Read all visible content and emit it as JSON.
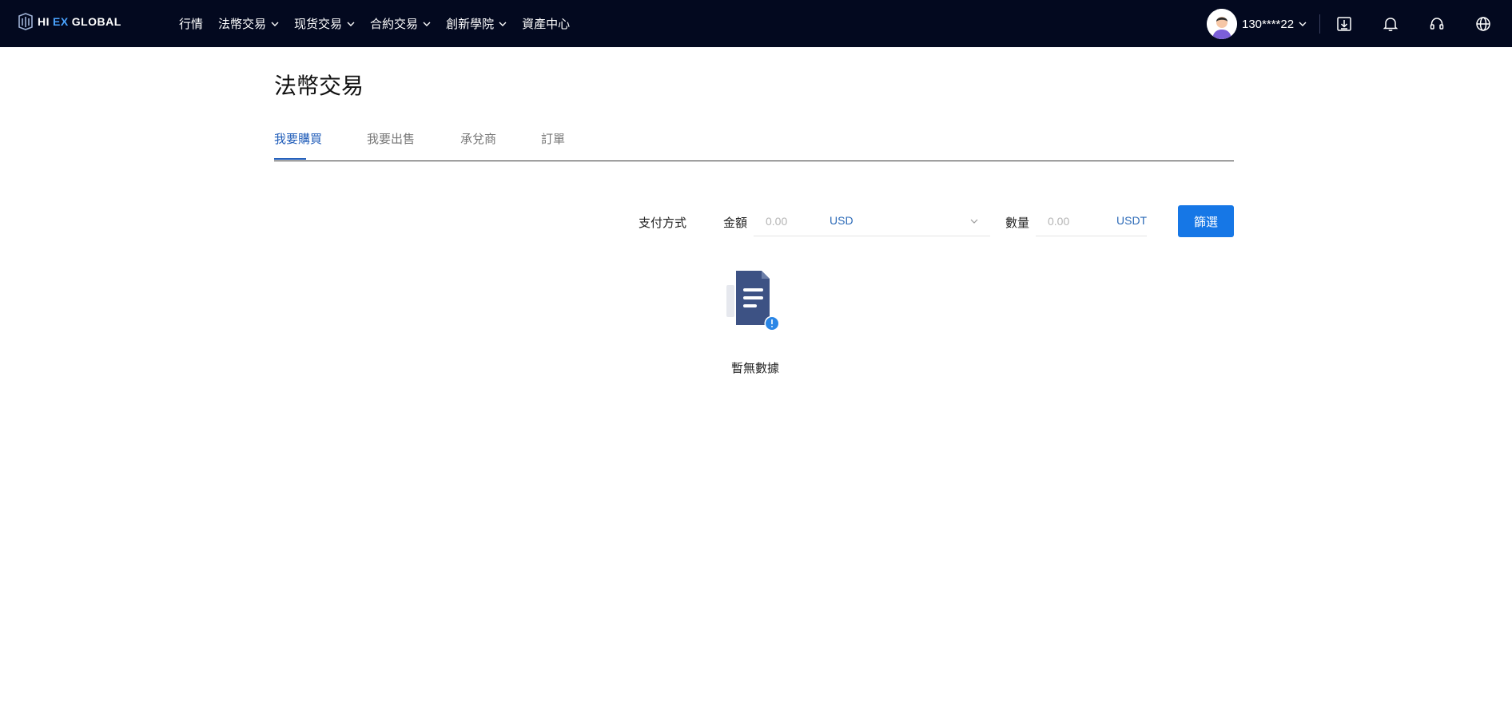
{
  "header": {
    "logo": {
      "hi": "HI",
      "ex": "EX",
      "rest": " GLOBAL"
    },
    "nav": [
      {
        "label": "行情",
        "dropdown": false
      },
      {
        "label": "法幣交易",
        "dropdown": true
      },
      {
        "label": "现货交易",
        "dropdown": true
      },
      {
        "label": "合約交易",
        "dropdown": true
      },
      {
        "label": "創新學院",
        "dropdown": true
      },
      {
        "label": "資產中心",
        "dropdown": false
      }
    ],
    "user": {
      "name": "130****22"
    },
    "icons": [
      "download-icon",
      "bell-icon",
      "headset-icon",
      "globe-icon"
    ]
  },
  "page": {
    "title": "法幣交易",
    "tabs": [
      {
        "label": "我要購買",
        "active": true
      },
      {
        "label": "我要出售",
        "active": false
      },
      {
        "label": "承兌商",
        "active": false
      },
      {
        "label": "訂單",
        "active": false
      }
    ]
  },
  "filters": {
    "payment_label": "支付方式",
    "amount_label": "金額",
    "amount_placeholder": "0.00",
    "amount_currency": "USD",
    "quantity_label": "數量",
    "quantity_placeholder": "0.00",
    "quantity_currency": "USDT",
    "filter_button": "篩選"
  },
  "empty_state": {
    "text": "暫無數據"
  },
  "colors": {
    "topbar_bg": "#03091f",
    "accent": "#1677e6",
    "tab_active": "#1e5bb8"
  }
}
